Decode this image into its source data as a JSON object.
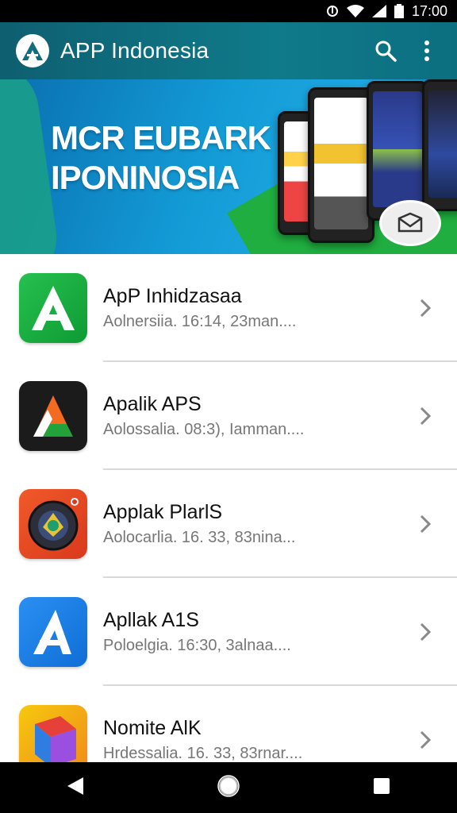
{
  "status": {
    "time": "17:00",
    "icons": [
      "sync-icon",
      "wifi-icon",
      "signal-icon",
      "battery-icon"
    ]
  },
  "appbar": {
    "title": "APP Indonesia",
    "search_icon": "search-icon",
    "menu_icon": "more-vert-icon"
  },
  "banner": {
    "line1": "MCR EUBARK",
    "line2": "IPONINOSIA"
  },
  "apps": [
    {
      "name": "ApP Inhidzasaa",
      "subtitle": "Aolnersiia. 16:14, 23man....",
      "icon": "green-a-icon"
    },
    {
      "name": "Apalik APS",
      "subtitle": "Aolossalia. 08:3), Iamman....",
      "icon": "dark-a-icon"
    },
    {
      "name": "Applak PlarlS",
      "subtitle": "Aolocarlia. 16. 33, 83nina...",
      "icon": "camera-lens-icon"
    },
    {
      "name": "Apllak A1S",
      "subtitle": "Poloelgia. 16:30, 3alnaa....",
      "icon": "blue-a-icon"
    },
    {
      "name": "Nomite AlK",
      "subtitle": "Hrdessalia. 16. 33, 83rnar....",
      "icon": "cube-icon"
    }
  ],
  "colors": {
    "appbar": "#0f7a8a",
    "accent_green": "#1fae3f",
    "banner_blue": "#139bd6"
  }
}
